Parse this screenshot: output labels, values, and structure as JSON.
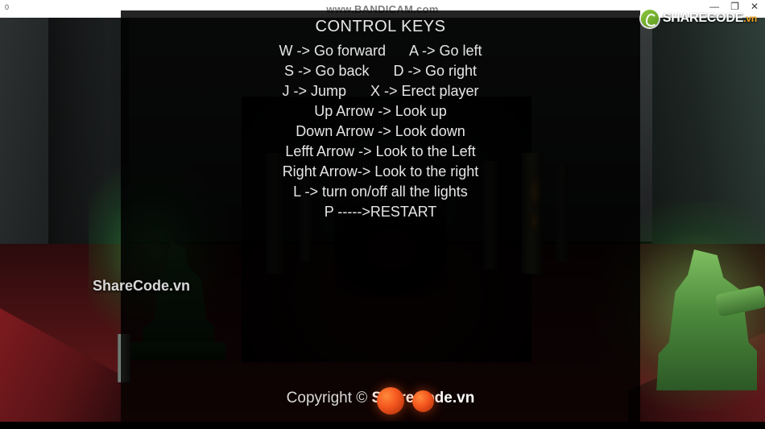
{
  "chrome": {
    "left_marker": "0",
    "recorder_label": "www.BANDICAM.com",
    "window_controls": [
      {
        "name": "minimize",
        "glyph": "—"
      },
      {
        "name": "maximize",
        "glyph": "❐"
      },
      {
        "name": "close",
        "glyph": "✕"
      }
    ]
  },
  "watermark": {
    "logo_name": "sharecode-leaf-icon",
    "text": "SHARECODE",
    "suffix": ".vn",
    "mid_text": "ShareCode.vn"
  },
  "overlay": {
    "title": "CONTROL KEYS",
    "lines": [
      "W -> Go forward      A -> Go left",
      "S -> Go back      D -> Go right",
      "J -> Jump      X -> Erect player",
      "Up Arrow -> Look up",
      "Down Arrow -> Look down",
      "Lefft Arrow -> Look to the Left",
      "Right Arrow-> Look to the right",
      "L -> turn on/off all the lights",
      "P ----->RESTART"
    ],
    "copyright_prefix": "Copyright © ",
    "copyright_brand": "ShareCode.vn"
  },
  "scene": {
    "objects": [
      {
        "name": "statue-left",
        "color": "#2f7a36"
      },
      {
        "name": "statue-right",
        "color": "#7fbf60"
      },
      {
        "name": "orange-sphere-1",
        "color": "#f4551d"
      },
      {
        "name": "orange-sphere-2",
        "color": "#f4551d"
      },
      {
        "name": "red-floor",
        "color": "#6d191c"
      },
      {
        "name": "grey-wall",
        "color": "#3a3d3e"
      }
    ]
  }
}
